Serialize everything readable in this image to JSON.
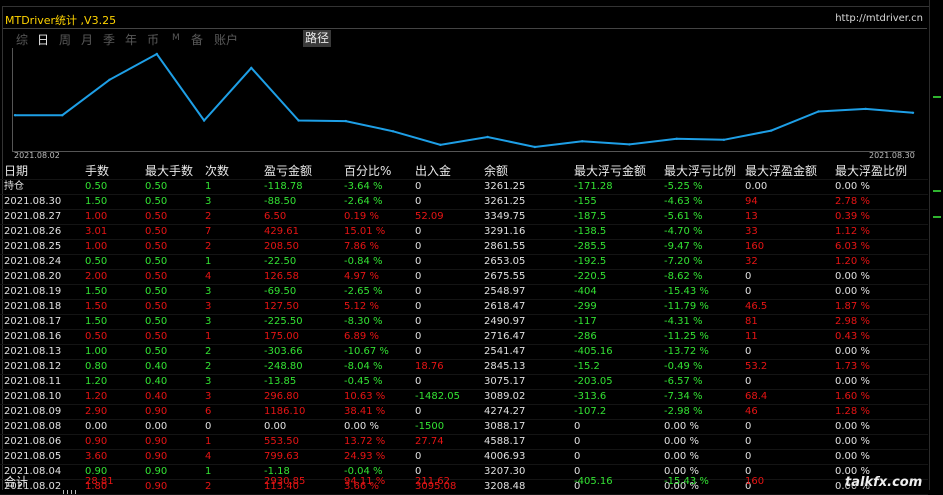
{
  "window": {
    "title": "MTDriver统计 ,V3.25",
    "url": "http://mtdriver.cn"
  },
  "nav": {
    "tabs": [
      {
        "label": "综",
        "active": false
      },
      {
        "label": "日",
        "active": true
      },
      {
        "label": "周",
        "active": false
      },
      {
        "label": "月",
        "active": false
      },
      {
        "label": "季",
        "active": false
      },
      {
        "label": "年",
        "active": false
      },
      {
        "label": "币",
        "active": false
      },
      {
        "label": "M",
        "active": false
      },
      {
        "label": "备",
        "active": false
      },
      {
        "label": "账户",
        "active": false
      }
    ],
    "route_label": "路径"
  },
  "chart_data": {
    "type": "line",
    "x": [
      "2021.08.02",
      "2021.08.04",
      "2021.08.05",
      "2021.08.06",
      "2021.08.08",
      "2021.08.09",
      "2021.08.10",
      "2021.08.11",
      "2021.08.12",
      "2021.08.13",
      "2021.08.16",
      "2021.08.17",
      "2021.08.18",
      "2021.08.19",
      "2021.08.20",
      "2021.08.24",
      "2021.08.25",
      "2021.08.26",
      "2021.08.27",
      "2021.08.30"
    ],
    "values": [
      3208.48,
      3207.3,
      4006.93,
      4588.17,
      3088.17,
      4274.27,
      3089.02,
      3075.17,
      2845.13,
      2541.47,
      2716.47,
      2490.97,
      2618.47,
      2548.97,
      2675.55,
      2653.05,
      2861.55,
      3291.16,
      3349.75,
      3261.25
    ],
    "xlabel_start": "2021.08.02",
    "xlabel_end": "2021.08.30",
    "line_color": "#1e9fe6"
  },
  "table": {
    "headers": [
      "日期",
      "手数",
      "最大手数",
      "次数",
      "盈亏金额",
      "百分比%",
      "出入金",
      "余额",
      "最大浮亏金额",
      "最大浮亏比例",
      "最大浮盈金额",
      "最大浮盈比例"
    ],
    "rows": [
      {
        "c": [
          "持仓",
          "0.50",
          "0.50",
          "1",
          "-118.78",
          "-3.64 %",
          "0",
          "3261.25",
          "-171.28",
          "-5.25 %",
          "0.00",
          "0.00 %"
        ],
        "k": [
          "w",
          "g",
          "g",
          "g",
          "g",
          "g",
          "w",
          "w",
          "g",
          "g",
          "w",
          "w"
        ]
      },
      {
        "c": [
          "2021.08.30",
          "1.50",
          "0.50",
          "3",
          "-88.50",
          "-2.64 %",
          "0",
          "3261.25",
          "-155",
          "-4.63 %",
          "94",
          "2.78 %"
        ],
        "k": [
          "w",
          "g",
          "g",
          "g",
          "g",
          "g",
          "w",
          "w",
          "g",
          "g",
          "r",
          "r"
        ]
      },
      {
        "c": [
          "2021.08.27",
          "1.00",
          "0.50",
          "2",
          "6.50",
          "0.19 %",
          "52.09",
          "3349.75",
          "-187.5",
          "-5.61 %",
          "13",
          "0.39 %"
        ],
        "k": [
          "w",
          "r",
          "r",
          "r",
          "r",
          "r",
          "r",
          "w",
          "g",
          "g",
          "r",
          "r"
        ]
      },
      {
        "c": [
          "2021.08.26",
          "3.01",
          "0.50",
          "7",
          "429.61",
          "15.01 %",
          "0",
          "3291.16",
          "-138.5",
          "-4.70 %",
          "33",
          "1.12 %"
        ],
        "k": [
          "w",
          "r",
          "r",
          "r",
          "r",
          "r",
          "w",
          "w",
          "g",
          "g",
          "r",
          "r"
        ]
      },
      {
        "c": [
          "2021.08.25",
          "1.00",
          "0.50",
          "2",
          "208.50",
          "7.86 %",
          "0",
          "2861.55",
          "-285.5",
          "-9.47 %",
          "160",
          "6.03 %"
        ],
        "k": [
          "w",
          "r",
          "r",
          "r",
          "r",
          "r",
          "w",
          "w",
          "g",
          "g",
          "r",
          "r"
        ]
      },
      {
        "c": [
          "2021.08.24",
          "0.50",
          "0.50",
          "1",
          "-22.50",
          "-0.84 %",
          "0",
          "2653.05",
          "-192.5",
          "-7.20 %",
          "32",
          "1.20 %"
        ],
        "k": [
          "w",
          "g",
          "g",
          "g",
          "g",
          "g",
          "w",
          "w",
          "g",
          "g",
          "r",
          "r"
        ]
      },
      {
        "c": [
          "2021.08.20",
          "2.00",
          "0.50",
          "4",
          "126.58",
          "4.97 %",
          "0",
          "2675.55",
          "-220.5",
          "-8.62 %",
          "0",
          "0.00 %"
        ],
        "k": [
          "w",
          "r",
          "r",
          "r",
          "r",
          "r",
          "w",
          "w",
          "g",
          "g",
          "w",
          "w"
        ]
      },
      {
        "c": [
          "2021.08.19",
          "1.50",
          "0.50",
          "3",
          "-69.50",
          "-2.65 %",
          "0",
          "2548.97",
          "-404",
          "-15.43 %",
          "0",
          "0.00 %"
        ],
        "k": [
          "w",
          "g",
          "g",
          "g",
          "g",
          "g",
          "w",
          "w",
          "g",
          "g",
          "w",
          "w"
        ]
      },
      {
        "c": [
          "2021.08.18",
          "1.50",
          "0.50",
          "3",
          "127.50",
          "5.12 %",
          "0",
          "2618.47",
          "-299",
          "-11.79 %",
          "46.5",
          "1.87 %"
        ],
        "k": [
          "w",
          "r",
          "r",
          "r",
          "r",
          "r",
          "w",
          "w",
          "g",
          "g",
          "r",
          "r"
        ]
      },
      {
        "c": [
          "2021.08.17",
          "1.50",
          "0.50",
          "3",
          "-225.50",
          "-8.30 %",
          "0",
          "2490.97",
          "-117",
          "-4.31 %",
          "81",
          "2.98 %"
        ],
        "k": [
          "w",
          "g",
          "g",
          "g",
          "g",
          "g",
          "w",
          "w",
          "g",
          "g",
          "r",
          "r"
        ]
      },
      {
        "c": [
          "2021.08.16",
          "0.50",
          "0.50",
          "1",
          "175.00",
          "6.89 %",
          "0",
          "2716.47",
          "-286",
          "-11.25 %",
          "11",
          "0.43 %"
        ],
        "k": [
          "w",
          "r",
          "r",
          "r",
          "r",
          "r",
          "w",
          "w",
          "g",
          "g",
          "r",
          "r"
        ]
      },
      {
        "c": [
          "2021.08.13",
          "1.00",
          "0.50",
          "2",
          "-303.66",
          "-10.67 %",
          "0",
          "2541.47",
          "-405.16",
          "-13.72 %",
          "0",
          "0.00 %"
        ],
        "k": [
          "w",
          "g",
          "g",
          "g",
          "g",
          "g",
          "w",
          "w",
          "g",
          "g",
          "w",
          "w"
        ]
      },
      {
        "c": [
          "2021.08.12",
          "0.80",
          "0.40",
          "2",
          "-248.80",
          "-8.04 %",
          "18.76",
          "2845.13",
          "-15.2",
          "-0.49 %",
          "53.2",
          "1.73 %"
        ],
        "k": [
          "w",
          "g",
          "g",
          "g",
          "g",
          "g",
          "r",
          "w",
          "g",
          "g",
          "r",
          "r"
        ]
      },
      {
        "c": [
          "2021.08.11",
          "1.20",
          "0.40",
          "3",
          "-13.85",
          "-0.45 %",
          "0",
          "3075.17",
          "-203.05",
          "-6.57 %",
          "0",
          "0.00 %"
        ],
        "k": [
          "w",
          "g",
          "g",
          "g",
          "g",
          "g",
          "w",
          "w",
          "g",
          "g",
          "w",
          "w"
        ]
      },
      {
        "c": [
          "2021.08.10",
          "1.20",
          "0.40",
          "3",
          "296.80",
          "10.63 %",
          "-1482.05",
          "3089.02",
          "-313.6",
          "-7.34 %",
          "68.4",
          "1.60 %"
        ],
        "k": [
          "w",
          "r",
          "r",
          "r",
          "r",
          "r",
          "g",
          "w",
          "g",
          "g",
          "r",
          "r"
        ]
      },
      {
        "c": [
          "2021.08.09",
          "2.90",
          "0.90",
          "6",
          "1186.10",
          "38.41 %",
          "0",
          "4274.27",
          "-107.2",
          "-2.98 %",
          "46",
          "1.28 %"
        ],
        "k": [
          "w",
          "r",
          "r",
          "r",
          "r",
          "r",
          "w",
          "w",
          "g",
          "g",
          "r",
          "r"
        ]
      },
      {
        "c": [
          "2021.08.08",
          "0.00",
          "0.00",
          "0",
          "0.00",
          "0.00 %",
          "-1500",
          "3088.17",
          "0",
          "0.00 %",
          "0",
          "0.00 %"
        ],
        "k": [
          "w",
          "w",
          "w",
          "w",
          "w",
          "w",
          "g",
          "w",
          "w",
          "w",
          "w",
          "w"
        ]
      },
      {
        "c": [
          "2021.08.06",
          "0.90",
          "0.90",
          "1",
          "553.50",
          "13.72 %",
          "27.74",
          "4588.17",
          "0",
          "0.00 %",
          "0",
          "0.00 %"
        ],
        "k": [
          "w",
          "r",
          "r",
          "r",
          "r",
          "r",
          "r",
          "w",
          "w",
          "w",
          "w",
          "w"
        ]
      },
      {
        "c": [
          "2021.08.05",
          "3.60",
          "0.90",
          "4",
          "799.63",
          "24.93 %",
          "0",
          "4006.93",
          "0",
          "0.00 %",
          "0",
          "0.00 %"
        ],
        "k": [
          "w",
          "r",
          "r",
          "r",
          "r",
          "r",
          "w",
          "w",
          "w",
          "w",
          "w",
          "w"
        ]
      },
      {
        "c": [
          "2021.08.04",
          "0.90",
          "0.90",
          "1",
          "-1.18",
          "-0.04 %",
          "0",
          "3207.30",
          "0",
          "0.00 %",
          "0",
          "0.00 %"
        ],
        "k": [
          "w",
          "g",
          "g",
          "g",
          "g",
          "g",
          "w",
          "w",
          "w",
          "w",
          "w",
          "w"
        ]
      },
      {
        "c": [
          "2021.08.02",
          "1.80",
          "0.90",
          "2",
          "113.40",
          "3.66 %",
          "3095.08",
          "3208.48",
          "0",
          "0.00 %",
          "0",
          "0.00 %"
        ],
        "k": [
          "w",
          "r",
          "r",
          "r",
          "r",
          "r",
          "r",
          "w",
          "w",
          "w",
          "w",
          "w"
        ]
      }
    ],
    "total": {
      "label": "合计",
      "lots": "28.81",
      "pnl": "2930.85",
      "pct": "94.11 %",
      "flow": "211.62",
      "max_float_loss": "-405.16",
      "max_float_loss_pct": "-15.43 %",
      "max_float_profit": "160"
    }
  },
  "watermark": "talkfx.com",
  "colors": {
    "profit": "#e61414",
    "loss": "#33e233",
    "neutral": "#e0e0e0",
    "title": "#ffd400",
    "line": "#1e9fe6"
  }
}
